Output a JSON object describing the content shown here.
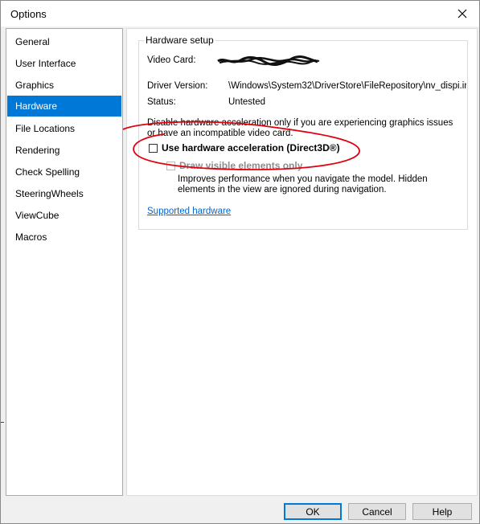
{
  "window": {
    "title": "Options"
  },
  "sidebar": {
    "items": [
      {
        "label": "General"
      },
      {
        "label": "User Interface"
      },
      {
        "label": "Graphics"
      },
      {
        "label": "Hardware",
        "selected": true
      },
      {
        "label": "File Locations"
      },
      {
        "label": "Rendering"
      },
      {
        "label": "Check Spelling"
      },
      {
        "label": "SteeringWheels"
      },
      {
        "label": "ViewCube"
      },
      {
        "label": "Macros"
      }
    ]
  },
  "hardware": {
    "group_title": "Hardware setup",
    "video_card_label": "Video Card:",
    "driver_version_label": "Driver Version:",
    "driver_version_value": "\\Windows\\System32\\DriverStore\\FileRepository\\nv_dispi.ir",
    "status_label": "Status:",
    "status_value": "Untested",
    "description": "Disable hardware acceleration only if you are experiencing graphics issues or have an incompatible video card.",
    "use_hw_accel_label": "Use hardware acceleration (Direct3D®)",
    "draw_visible_label": "Draw visible elements only",
    "draw_visible_desc": "Improves performance when you navigate the model. Hidden elements in the view are ignored during navigation.",
    "supported_hardware_link": "Supported hardware"
  },
  "footer": {
    "ok_label": "OK",
    "cancel_label": "Cancel",
    "help_label": "Help"
  },
  "colors": {
    "selection": "#0078d7",
    "link": "#0066cc",
    "annotation": "#e0000d"
  },
  "icons": {
    "close": "close-icon"
  }
}
